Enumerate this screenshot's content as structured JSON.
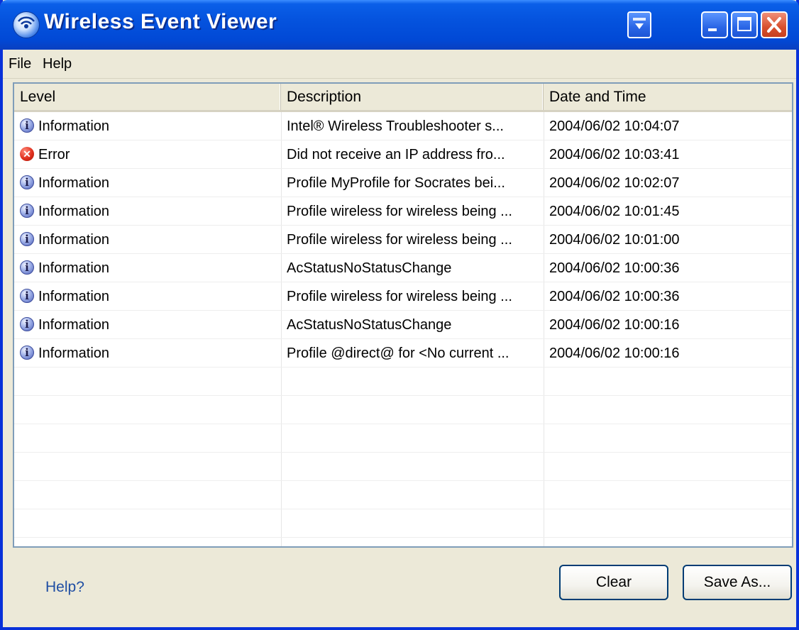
{
  "window": {
    "title": "Wireless Event Viewer"
  },
  "menu": {
    "items": [
      "File",
      "Help"
    ]
  },
  "table": {
    "columns": [
      "Level",
      "Description",
      "Date and Time"
    ],
    "rows": [
      {
        "level": "Information",
        "level_icon": "info-icon",
        "description": "Intel® Wireless Troubleshooter s...",
        "datetime": "2004/06/02 10:04:07"
      },
      {
        "level": "Error",
        "level_icon": "error-icon",
        "description": "Did not receive an IP address fro...",
        "datetime": "2004/06/02 10:03:41"
      },
      {
        "level": "Information",
        "level_icon": "info-icon",
        "description": "Profile MyProfile for Socrates bei...",
        "datetime": "2004/06/02 10:02:07"
      },
      {
        "level": "Information",
        "level_icon": "info-icon",
        "description": "Profile wireless for wireless being ...",
        "datetime": "2004/06/02 10:01:45"
      },
      {
        "level": "Information",
        "level_icon": "info-icon",
        "description": "Profile wireless for wireless being ...",
        "datetime": "2004/06/02 10:01:00"
      },
      {
        "level": "Information",
        "level_icon": "info-icon",
        "description": "AcStatusNoStatusChange",
        "datetime": "2004/06/02 10:00:36"
      },
      {
        "level": "Information",
        "level_icon": "info-icon",
        "description": "Profile wireless for wireless being ...",
        "datetime": "2004/06/02 10:00:36"
      },
      {
        "level": "Information",
        "level_icon": "info-icon",
        "description": "AcStatusNoStatusChange",
        "datetime": "2004/06/02 10:00:16"
      },
      {
        "level": "Information",
        "level_icon": "info-icon",
        "description": "Profile @direct@ for <No current ...",
        "datetime": "2004/06/02 10:00:16"
      }
    ]
  },
  "footer": {
    "help_link": "Help?",
    "clear_button": "Clear",
    "save_as_button": "Save As..."
  },
  "colors": {
    "titlebar": "#0553de",
    "close_button": "#d8502e",
    "link": "#1f4ea3"
  }
}
